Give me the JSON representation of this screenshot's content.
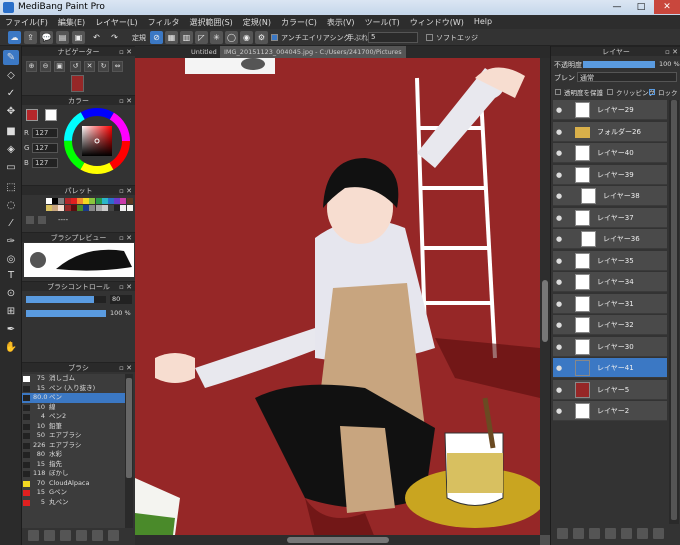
{
  "window": {
    "title": "MediBang Paint Pro",
    "minimize": "—",
    "maximize": "□",
    "close": "✕"
  },
  "menu": [
    "ファイル(F)",
    "編集(E)",
    "レイヤー(L)",
    "フィルタ",
    "選択範囲(S)",
    "定規(N)",
    "カラー(C)",
    "表示(V)",
    "ツール(T)",
    "ウィンドウ(W)",
    "Help"
  ],
  "toolbar": {
    "ruler_label": "定規",
    "antialias_label": "アンチエイリアシング",
    "stabilizer_label": "手ぶれ補正",
    "stabilizer_value": "5",
    "soft_edge_label": "ソフトエッジ"
  },
  "navigator": {
    "title": "ナビゲーター"
  },
  "color": {
    "title": "カラー",
    "r_label": "R",
    "g_label": "G",
    "b_label": "B",
    "r": "127",
    "g": "127",
    "b": "127",
    "primary_color": "#b4262a",
    "secondary_color": "#ffffff",
    "picked_color": "#7f7f7f"
  },
  "palette": {
    "title": "パレット",
    "value": "----"
  },
  "brush_preview": {
    "title": "ブラシプレビュー"
  },
  "brush_control": {
    "title": "ブラシコントロール",
    "size": "80",
    "opacity": "100 %",
    "size_level": 0.85,
    "opacity_level": 1.0
  },
  "brushes": {
    "title": "ブラシ",
    "items": [
      {
        "size": "75",
        "name": "消しゴム",
        "color": "#ffffff"
      },
      {
        "size": "15",
        "name": "ペン (入り抜き)",
        "color": "#222222"
      },
      {
        "size": "80.0",
        "name": "ペン",
        "color": "#222222",
        "selected": true
      },
      {
        "size": "10",
        "name": "線",
        "color": "#222222"
      },
      {
        "size": "4",
        "name": "ペン2",
        "color": "#222222"
      },
      {
        "size": "10",
        "name": "鉛筆",
        "color": "#222222"
      },
      {
        "size": "50",
        "name": "エアブラシ",
        "color": "#222222"
      },
      {
        "size": "226",
        "name": "エアブラシ",
        "color": "#222222"
      },
      {
        "size": "80",
        "name": "水彩",
        "color": "#222222"
      },
      {
        "size": "15",
        "name": "指先",
        "color": "#222222"
      },
      {
        "size": "118",
        "name": "ぼかし",
        "color": "#222222"
      },
      {
        "size": "70",
        "name": "CloudAlpaca",
        "color": "#f2d822"
      },
      {
        "size": "15",
        "name": "Gペン",
        "color": "#e02020"
      },
      {
        "size": "5",
        "name": "丸ペン",
        "color": "#e02020"
      }
    ]
  },
  "canvas": {
    "tab_untitled": "Untitled",
    "tab_file": "IMG_20151123_004045.jpg - C:/Users/241700/Pictures",
    "background": "#962727"
  },
  "layers": {
    "title": "レイヤー",
    "opacity_label": "不透明度",
    "opacity_value": "100 %",
    "blend_label": "ブレンド",
    "blend_value": "通常",
    "protect_label": "透明度を保護",
    "clipping_label": "クリッピング",
    "lock_label": "ロック",
    "items": [
      {
        "name": "レイヤー29"
      },
      {
        "name": "フォルダー26",
        "folder": true
      },
      {
        "name": "レイヤー40"
      },
      {
        "name": "レイヤー39"
      },
      {
        "name": "レイヤー38",
        "indent": true
      },
      {
        "name": "レイヤー37"
      },
      {
        "name": "レイヤー36",
        "indent": true
      },
      {
        "name": "レイヤー35"
      },
      {
        "name": "レイヤー34"
      },
      {
        "name": "レイヤー31"
      },
      {
        "name": "レイヤー32"
      },
      {
        "name": "レイヤー30"
      },
      {
        "name": "レイヤー41",
        "selected": true
      },
      {
        "name": "レイヤー5"
      },
      {
        "name": "レイヤー2"
      }
    ]
  }
}
